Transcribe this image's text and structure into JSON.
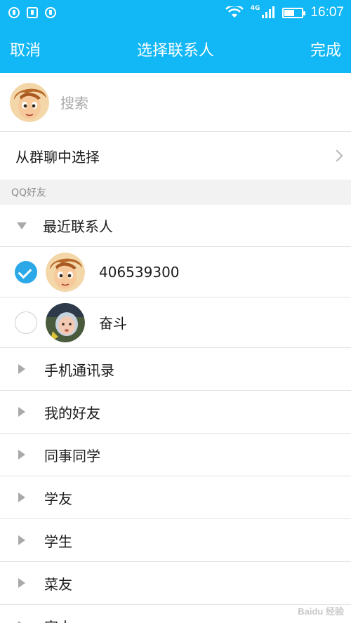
{
  "status_bar": {
    "network_label": "4G",
    "time": "16:07",
    "battery_level": 0.55
  },
  "nav": {
    "cancel_label": "取消",
    "title": "选择联系人",
    "done_label": "完成"
  },
  "search": {
    "placeholder": "搜索"
  },
  "group_chat": {
    "label": "从群聊中选择"
  },
  "section": {
    "label": "QQ好友"
  },
  "groups": {
    "recent": {
      "label": "最近联系人",
      "expanded": true
    },
    "contacts": [
      {
        "name": "406539300",
        "selected": true,
        "avatar": "cartoon-boy"
      },
      {
        "name": "奋斗",
        "selected": false,
        "avatar": "baby-photo"
      }
    ],
    "collapsed": [
      {
        "label": "手机通讯录"
      },
      {
        "label": "我的好友"
      },
      {
        "label": "同事同学"
      },
      {
        "label": "学友"
      },
      {
        "label": "学生"
      },
      {
        "label": "菜友"
      },
      {
        "label": "家人"
      }
    ]
  },
  "watermark": "Baidu 经验",
  "colors": {
    "accent": "#12b7f5",
    "check": "#2aa8e8"
  }
}
